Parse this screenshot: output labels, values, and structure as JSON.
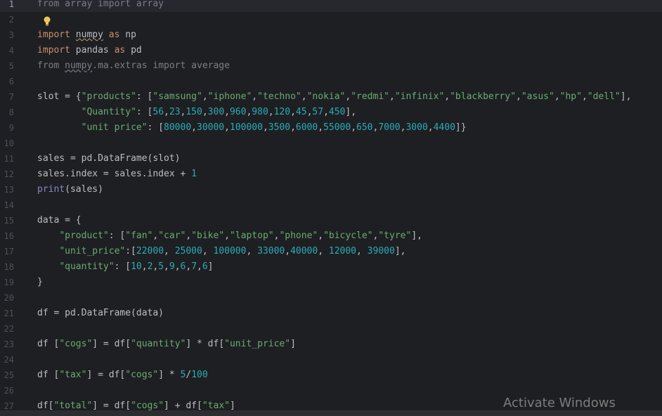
{
  "lines": [
    {
      "n": "1",
      "tokens": [
        {
          "t": "cm",
          "v": "from array import array"
        }
      ]
    },
    {
      "n": "2",
      "tokens": []
    },
    {
      "n": "3",
      "tokens": [
        {
          "t": "kw",
          "v": "import "
        },
        {
          "t": "id-wavy",
          "v": "numpy"
        },
        {
          "t": "kw",
          "v": " as "
        },
        {
          "t": "id",
          "v": "np"
        }
      ]
    },
    {
      "n": "4",
      "tokens": [
        {
          "t": "kw",
          "v": "import "
        },
        {
          "t": "id",
          "v": "pandas"
        },
        {
          "t": "kw",
          "v": " as "
        },
        {
          "t": "id",
          "v": "pd"
        }
      ]
    },
    {
      "n": "5",
      "tokens": [
        {
          "t": "cm",
          "v": "from "
        },
        {
          "t": "cm-wavy",
          "v": "numpy"
        },
        {
          "t": "cm",
          "v": ".ma.extras import average"
        }
      ]
    },
    {
      "n": "6",
      "tokens": []
    },
    {
      "n": "7",
      "tokens": [
        {
          "t": "id",
          "v": "slot = {"
        },
        {
          "t": "str",
          "v": "\"products\""
        },
        {
          "t": "id",
          "v": ": ["
        },
        {
          "t": "str",
          "v": "\"samsung\""
        },
        {
          "t": "id",
          "v": ","
        },
        {
          "t": "str",
          "v": "\"iphone\""
        },
        {
          "t": "id",
          "v": ","
        },
        {
          "t": "str",
          "v": "\"techno\""
        },
        {
          "t": "id",
          "v": ","
        },
        {
          "t": "str",
          "v": "\"nokia\""
        },
        {
          "t": "id",
          "v": ","
        },
        {
          "t": "str",
          "v": "\"redmi\""
        },
        {
          "t": "id",
          "v": ","
        },
        {
          "t": "str",
          "v": "\"infinix\""
        },
        {
          "t": "id",
          "v": ","
        },
        {
          "t": "str",
          "v": "\"blackberry\""
        },
        {
          "t": "id",
          "v": ","
        },
        {
          "t": "str",
          "v": "\"asus\""
        },
        {
          "t": "id",
          "v": ","
        },
        {
          "t": "str",
          "v": "\"hp\""
        },
        {
          "t": "id",
          "v": ","
        },
        {
          "t": "str",
          "v": "\"dell\""
        },
        {
          "t": "id",
          "v": "],"
        }
      ]
    },
    {
      "n": "8",
      "tokens": [
        {
          "t": "id",
          "v": "        "
        },
        {
          "t": "str",
          "v": "\"Quantity\""
        },
        {
          "t": "id",
          "v": ": ["
        },
        {
          "t": "num",
          "v": "56"
        },
        {
          "t": "id",
          "v": ","
        },
        {
          "t": "num",
          "v": "23"
        },
        {
          "t": "id",
          "v": ","
        },
        {
          "t": "num",
          "v": "150"
        },
        {
          "t": "id",
          "v": ","
        },
        {
          "t": "num",
          "v": "300"
        },
        {
          "t": "id",
          "v": ","
        },
        {
          "t": "num",
          "v": "960"
        },
        {
          "t": "id",
          "v": ","
        },
        {
          "t": "num",
          "v": "980"
        },
        {
          "t": "id",
          "v": ","
        },
        {
          "t": "num",
          "v": "120"
        },
        {
          "t": "id",
          "v": ","
        },
        {
          "t": "num",
          "v": "45"
        },
        {
          "t": "id",
          "v": ","
        },
        {
          "t": "num",
          "v": "57"
        },
        {
          "t": "id",
          "v": ","
        },
        {
          "t": "num",
          "v": "450"
        },
        {
          "t": "id",
          "v": "],"
        }
      ]
    },
    {
      "n": "9",
      "tokens": [
        {
          "t": "id",
          "v": "        "
        },
        {
          "t": "str",
          "v": "\"unit price\""
        },
        {
          "t": "id",
          "v": ": ["
        },
        {
          "t": "num",
          "v": "80000"
        },
        {
          "t": "id",
          "v": ","
        },
        {
          "t": "num",
          "v": "30000"
        },
        {
          "t": "id",
          "v": ","
        },
        {
          "t": "num",
          "v": "100000"
        },
        {
          "t": "id",
          "v": ","
        },
        {
          "t": "num",
          "v": "3500"
        },
        {
          "t": "id",
          "v": ","
        },
        {
          "t": "num",
          "v": "6000"
        },
        {
          "t": "id",
          "v": ","
        },
        {
          "t": "num",
          "v": "55000"
        },
        {
          "t": "id",
          "v": ","
        },
        {
          "t": "num",
          "v": "650"
        },
        {
          "t": "id",
          "v": ","
        },
        {
          "t": "num",
          "v": "7000"
        },
        {
          "t": "id",
          "v": ","
        },
        {
          "t": "num",
          "v": "3000"
        },
        {
          "t": "id",
          "v": ","
        },
        {
          "t": "num",
          "v": "4400"
        },
        {
          "t": "id",
          "v": "]}"
        }
      ]
    },
    {
      "n": "10",
      "tokens": []
    },
    {
      "n": "11",
      "tokens": [
        {
          "t": "id",
          "v": "sales = pd.DataFrame(slot)"
        }
      ]
    },
    {
      "n": "12",
      "tokens": [
        {
          "t": "id",
          "v": "sales.index = sales.index + "
        },
        {
          "t": "num",
          "v": "1"
        }
      ]
    },
    {
      "n": "13",
      "tokens": [
        {
          "t": "bi",
          "v": "print"
        },
        {
          "t": "id",
          "v": "(sales)"
        }
      ]
    },
    {
      "n": "14",
      "tokens": []
    },
    {
      "n": "15",
      "tokens": [
        {
          "t": "id",
          "v": "data = {"
        }
      ]
    },
    {
      "n": "16",
      "tokens": [
        {
          "t": "id",
          "v": "    "
        },
        {
          "t": "str",
          "v": "\"product\""
        },
        {
          "t": "id",
          "v": ": ["
        },
        {
          "t": "str",
          "v": "\"fan\""
        },
        {
          "t": "id",
          "v": ","
        },
        {
          "t": "str",
          "v": "\"car\""
        },
        {
          "t": "id",
          "v": ","
        },
        {
          "t": "str",
          "v": "\"bike\""
        },
        {
          "t": "id",
          "v": ","
        },
        {
          "t": "str",
          "v": "\"laptop\""
        },
        {
          "t": "id",
          "v": ","
        },
        {
          "t": "str",
          "v": "\"phone\""
        },
        {
          "t": "id",
          "v": ","
        },
        {
          "t": "str",
          "v": "\"bicycle\""
        },
        {
          "t": "id",
          "v": ","
        },
        {
          "t": "str",
          "v": "\"tyre\""
        },
        {
          "t": "id",
          "v": "],"
        }
      ]
    },
    {
      "n": "17",
      "tokens": [
        {
          "t": "id",
          "v": "    "
        },
        {
          "t": "str",
          "v": "\"unit_price\""
        },
        {
          "t": "id",
          "v": ":["
        },
        {
          "t": "num",
          "v": "22000"
        },
        {
          "t": "id",
          "v": ", "
        },
        {
          "t": "num",
          "v": "25000"
        },
        {
          "t": "id",
          "v": ", "
        },
        {
          "t": "num",
          "v": "100000"
        },
        {
          "t": "id",
          "v": ", "
        },
        {
          "t": "num",
          "v": "33000"
        },
        {
          "t": "id",
          "v": ","
        },
        {
          "t": "num",
          "v": "40000"
        },
        {
          "t": "id",
          "v": ", "
        },
        {
          "t": "num",
          "v": "12000"
        },
        {
          "t": "id",
          "v": ", "
        },
        {
          "t": "num",
          "v": "39000"
        },
        {
          "t": "id",
          "v": "],"
        }
      ]
    },
    {
      "n": "18",
      "tokens": [
        {
          "t": "id",
          "v": "    "
        },
        {
          "t": "str",
          "v": "\"quantity\""
        },
        {
          "t": "id",
          "v": ": ["
        },
        {
          "t": "num",
          "v": "10"
        },
        {
          "t": "id",
          "v": ","
        },
        {
          "t": "num",
          "v": "2"
        },
        {
          "t": "id",
          "v": ","
        },
        {
          "t": "num",
          "v": "5"
        },
        {
          "t": "id",
          "v": ","
        },
        {
          "t": "num",
          "v": "9"
        },
        {
          "t": "id",
          "v": ","
        },
        {
          "t": "num",
          "v": "6"
        },
        {
          "t": "id",
          "v": ","
        },
        {
          "t": "num",
          "v": "7"
        },
        {
          "t": "id",
          "v": ","
        },
        {
          "t": "num",
          "v": "6"
        },
        {
          "t": "id",
          "v": "]"
        }
      ]
    },
    {
      "n": "19",
      "tokens": [
        {
          "t": "id",
          "v": "}"
        }
      ]
    },
    {
      "n": "20",
      "tokens": []
    },
    {
      "n": "21",
      "tokens": [
        {
          "t": "id",
          "v": "df = pd.DataFrame(data)"
        }
      ]
    },
    {
      "n": "22",
      "tokens": []
    },
    {
      "n": "23",
      "tokens": [
        {
          "t": "id",
          "v": "df ["
        },
        {
          "t": "str",
          "v": "\"cogs\""
        },
        {
          "t": "id",
          "v": "] = df["
        },
        {
          "t": "str",
          "v": "\"quantity\""
        },
        {
          "t": "id",
          "v": "] * df["
        },
        {
          "t": "str",
          "v": "\"unit_price\""
        },
        {
          "t": "id",
          "v": "]"
        }
      ]
    },
    {
      "n": "24",
      "tokens": []
    },
    {
      "n": "25",
      "tokens": [
        {
          "t": "id",
          "v": "df ["
        },
        {
          "t": "str",
          "v": "\"tax\""
        },
        {
          "t": "id",
          "v": "] = df["
        },
        {
          "t": "str",
          "v": "\"cogs\""
        },
        {
          "t": "id",
          "v": "] * "
        },
        {
          "t": "num",
          "v": "5"
        },
        {
          "t": "id",
          "v": "/"
        },
        {
          "t": "num",
          "v": "100"
        }
      ]
    },
    {
      "n": "26",
      "tokens": []
    },
    {
      "n": "27",
      "tokens": [
        {
          "t": "id",
          "v": "df["
        },
        {
          "t": "str",
          "v": "\"total\""
        },
        {
          "t": "id",
          "v": "] = df["
        },
        {
          "t": "str",
          "v": "\"cogs\""
        },
        {
          "t": "id",
          "v": "] + df["
        },
        {
          "t": "str",
          "v": "\"tax\""
        },
        {
          "t": "id",
          "v": "]"
        }
      ]
    }
  ],
  "current_line": "1",
  "icons": {
    "intention_bulb": "lightbulb-icon"
  },
  "colors": {
    "background": "#1e1f22",
    "keyword": "#cf8e6d",
    "string": "#6aab73",
    "number": "#2aacb8",
    "comment": "#7a7e85",
    "builtin": "#8888c6",
    "text": "#bcbec4",
    "bulb": "#f2c55c"
  },
  "watermark": {
    "text": "Activate Windows"
  }
}
